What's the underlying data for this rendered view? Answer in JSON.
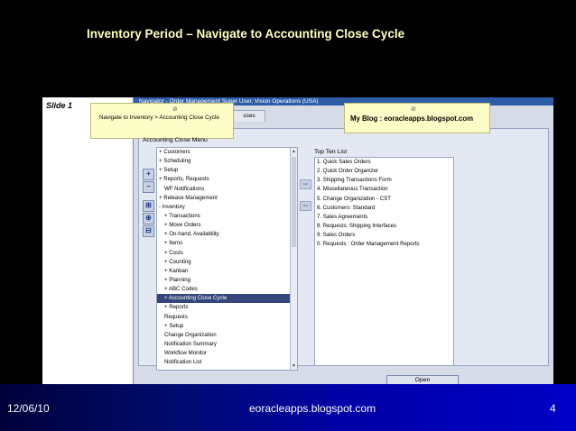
{
  "slide": {
    "title": "Inventory Period – Navigate to Accounting Close Cycle",
    "label": "Slide 1"
  },
  "footer": {
    "date": "12/06/10",
    "site": "eoracleapps.blogspot.com",
    "page": "4"
  },
  "window": {
    "title": "Navigator - Order Management Super User, Vision Operations (USA)",
    "tab_fragment": "sses"
  },
  "tooltips": {
    "nav_path": "Navigate to Inventory > Accounting Close Cycle",
    "blog": "My Blog : eoracleapps.blogspot.com"
  },
  "menu": {
    "label": "Accounting Close Menu",
    "items": [
      "+ Customers",
      "+ Scheduling",
      "+ Setup",
      "+ Reports, Requests",
      "WF Notifications",
      "+ Release Management",
      "- Inventory",
      "+ Transactions",
      "+ Move Orders",
      "+ On-hand, Availability",
      "+ Items",
      "+ Costs",
      "+ Counting",
      "+ Kanban",
      "+ Planning",
      "+ ABC Codes",
      "+ Accounting Close Cycle",
      "+ Reports",
      "Requests",
      "+ Setup",
      "Change Organization",
      "Notification Summary",
      "Workflow Monitor",
      "Notification List"
    ],
    "indents": [
      0,
      0,
      0,
      0,
      1,
      0,
      0,
      1,
      1,
      1,
      1,
      1,
      1,
      1,
      1,
      1,
      1,
      1,
      1,
      1,
      1,
      1,
      1,
      1
    ],
    "selected_index": 16
  },
  "top_ten": {
    "label": "Top Ten List",
    "items": [
      "1. Quick Sales Orders",
      "2. Quick Order Organizer",
      "3. Shipping Transactions Form",
      "4. Miscellaneous Transaction",
      "5. Change Organization - CST",
      "6. Customers: Standard",
      "7. Sales Agreements",
      "8. Requests: Shipping Interfaces",
      "9. Sales Orders",
      "0. Requests : Order Management Reports"
    ]
  },
  "buttons": {
    "open": "Open",
    "side_icons": [
      "plus-icon",
      "minus-icon",
      "expand-all-icon",
      "expand-branch-icon",
      "collapse-all-icon"
    ],
    "side_glyphs": [
      "+",
      "−",
      "⊞",
      "⊕",
      "⊟"
    ],
    "add_glyph": "⇨",
    "remove_glyph": "⇦"
  },
  "colors": {
    "title": "#ffffc0",
    "selection": "#35467a",
    "window": "#d6dbe8",
    "tooltip": "#fdfdc8"
  }
}
